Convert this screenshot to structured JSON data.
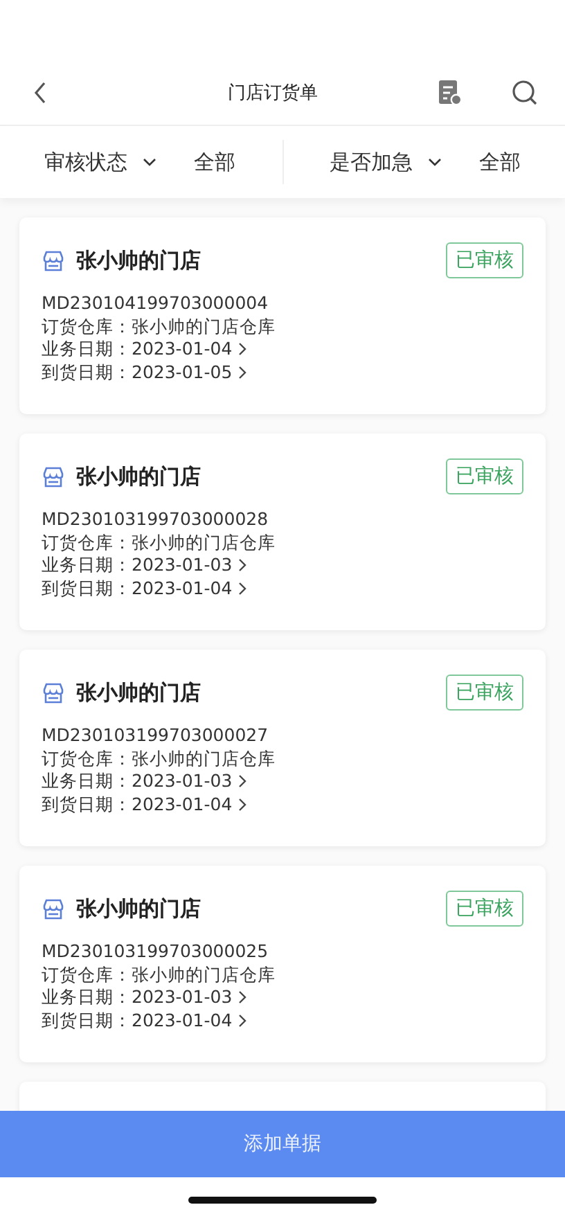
{
  "nav": {
    "title": "门店订货单"
  },
  "filters": [
    {
      "label": "审核状态",
      "value": "全部"
    },
    {
      "label": "是否加急",
      "value": "全部"
    }
  ],
  "orders": [
    {
      "store": "张小帅的门店",
      "status": "已审核",
      "code": "MD230104199703000004",
      "warehouse": "订货仓库：张小帅的门店仓库",
      "business_date": "业务日期：2023-01-04",
      "arrival_date": "到货日期：2023-01-05"
    },
    {
      "store": "张小帅的门店",
      "status": "已审核",
      "code": "MD230103199703000028",
      "warehouse": "订货仓库：张小帅的门店仓库",
      "business_date": "业务日期：2023-01-03",
      "arrival_date": "到货日期：2023-01-04"
    },
    {
      "store": "张小帅的门店",
      "status": "已审核",
      "code": "MD230103199703000027",
      "warehouse": "订货仓库：张小帅的门店仓库",
      "business_date": "业务日期：2023-01-03",
      "arrival_date": "到货日期：2023-01-04"
    },
    {
      "store": "张小帅的门店",
      "status": "已审核",
      "code": "MD230103199703000025",
      "warehouse": "订货仓库：张小帅的门店仓库",
      "business_date": "业务日期：2023-01-03",
      "arrival_date": "到货日期：2023-01-04"
    }
  ],
  "add_button": "添加单据"
}
